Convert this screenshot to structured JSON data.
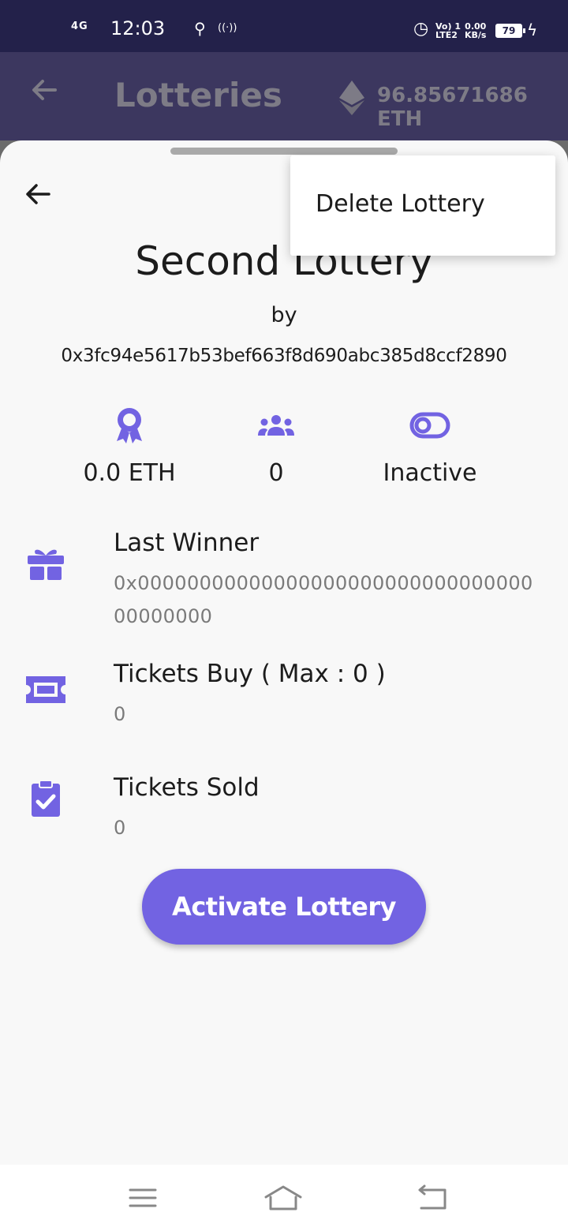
{
  "status_bar": {
    "network": "4G",
    "time": "12:03",
    "volte_line1": "Vo) 1",
    "volte_line2": "LTE2",
    "speed_value": "0.00",
    "speed_unit": "KB/s",
    "battery": "79"
  },
  "app_bar": {
    "title": "Lotteries",
    "balance": "96.85671686 ETH",
    "icons": [
      "back-arrow-icon",
      "ethereum-icon"
    ]
  },
  "sheet": {
    "title": "Second Lottery",
    "by_label": "by",
    "owner_address": "0x3fc94e5617b53bef663f8d690abc385d8ccf2890",
    "stats": {
      "prize": "0.0 ETH",
      "players": "0",
      "status": "Inactive"
    },
    "last_winner": {
      "label": "Last Winner",
      "value": "0x0000000000000000000000000000000000000000"
    },
    "tickets_buy": {
      "label": "Tickets Buy ( Max : 0 )",
      "value": "0"
    },
    "tickets_sold": {
      "label": "Tickets Sold",
      "value": "0"
    },
    "activate_label": "Activate Lottery"
  },
  "popup_menu": {
    "items": [
      {
        "label": "Delete Lottery"
      }
    ]
  },
  "colors": {
    "accent": "#7263e2",
    "status_bar": "#23214a",
    "app_bar_dimmed": "#3c375f"
  }
}
